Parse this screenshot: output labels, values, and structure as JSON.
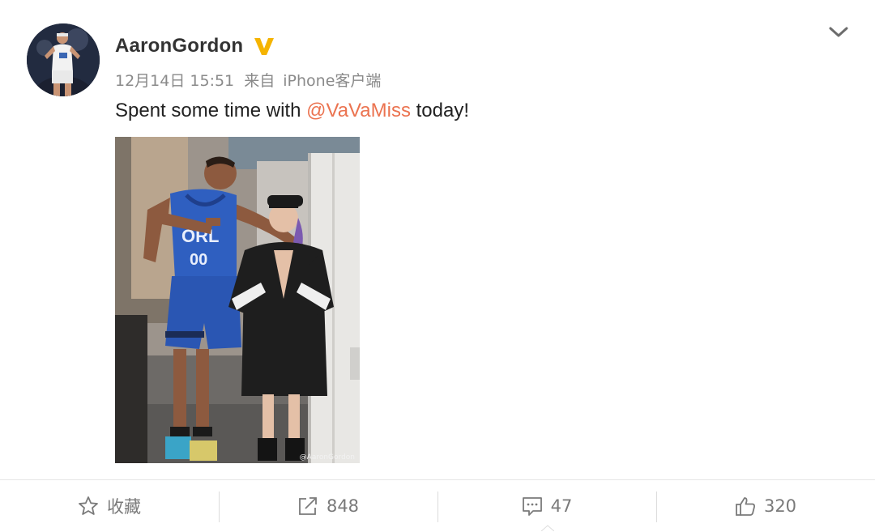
{
  "post": {
    "username": "AaronGordon",
    "verified_icon": "verified-v-badge-icon",
    "timestamp": "12月14日 15:51",
    "source_prefix": "来自",
    "source": "iPhone客户端",
    "text_before": "Spent some time with ",
    "mention": "@VaVaMiss",
    "text_after": " today!",
    "photo_watermark": "@AaronGordon",
    "jersey_text": "ORL",
    "jersey_number": "00"
  },
  "actions": {
    "favorite_label": "收藏",
    "repost_count": "848",
    "comment_count": "47",
    "like_count": "320"
  },
  "colors": {
    "username": "#333333",
    "meta": "#8a8a8a",
    "mention": "#eb7350",
    "verified": "#f5b400",
    "toolbar_text": "#7a7a7a"
  }
}
